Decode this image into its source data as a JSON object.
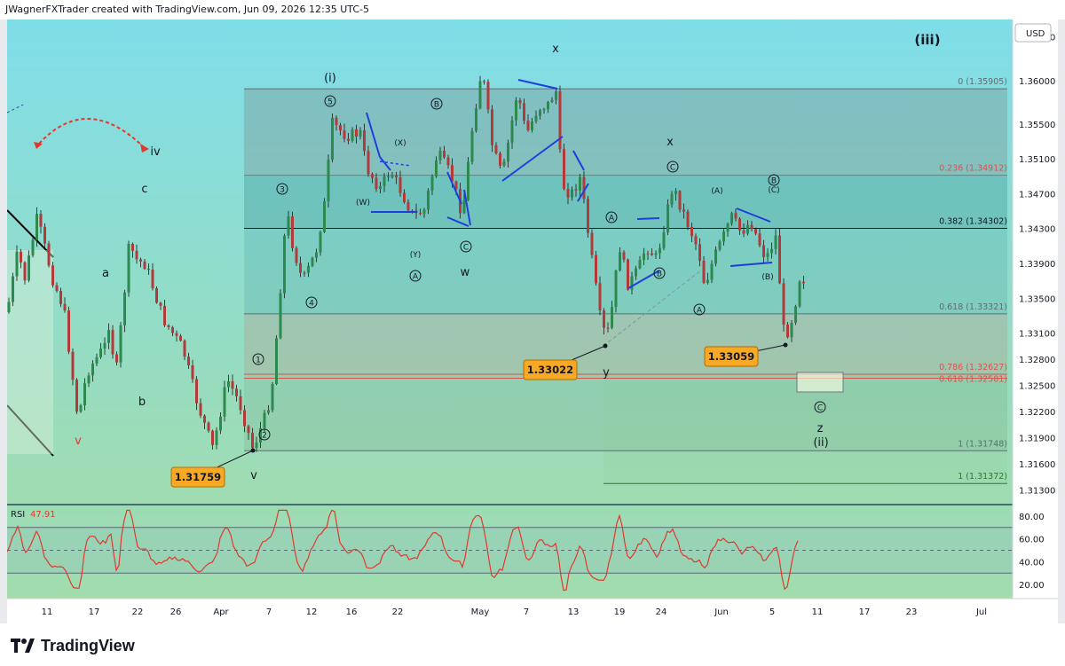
{
  "header": {
    "caption": "JWagnerFXTrader created with TradingView.com, Jun 09, 2026 12:35 UTC-5"
  },
  "currency_button": "USD",
  "footer": {
    "brand": "TradingView",
    "logo_icon": "tradingview-logo-icon"
  },
  "colors": {
    "bg_top": "#7fdde9",
    "bg_bottom": "#a8dca3",
    "candle_up": "#2d8a4e",
    "candle_down": "#b23a3a",
    "rsi": "#e0392e",
    "pattern_line": "#1f3fdc",
    "fib_red": "#d9534f",
    "label_bg": "#f7a824"
  },
  "chart_data": {
    "type": "candlestick",
    "symbol_currency": "USD",
    "y_axis": {
      "ticks": [
        "1.36500",
        "1.36000",
        "1.35500",
        "1.35100",
        "1.34700",
        "1.34300",
        "1.33900",
        "1.33500",
        "1.33100",
        "1.32800",
        "1.32500",
        "1.32200",
        "1.31900",
        "1.31600",
        "1.31300"
      ],
      "range": [
        1.3115,
        1.3665
      ]
    },
    "x_axis": {
      "ticks": [
        "11",
        "17",
        "22",
        "26",
        "Apr",
        "7",
        "12",
        "16",
        "22",
        "May",
        "7",
        "13",
        "19",
        "24",
        "Jun",
        "5",
        "11",
        "17",
        "23",
        "Jul"
      ]
    },
    "fib_levels": [
      {
        "label": "0 (1.35905)",
        "value": 1.35905,
        "color": "#5a6e74"
      },
      {
        "label": "0.236 (1.34912)",
        "value": 1.34912,
        "color": "#d9534f"
      },
      {
        "label": "0.382 (1.34302)",
        "value": 1.34302,
        "color": "#131722"
      },
      {
        "label": "0.618 (1.33321)",
        "value": 1.33321,
        "color": "#5a6e74"
      },
      {
        "label": "0.786 (1.32627)",
        "value": 1.32627,
        "color": "#d9534f"
      },
      {
        "label": "0.618 (1.32581)",
        "value": 1.32581,
        "color": "#d9534f"
      },
      {
        "label": "1 (1.31748)",
        "value": 1.31748,
        "color": "#5a6e74"
      },
      {
        "label": "1 (1.31372)",
        "value": 1.31372,
        "color": "#2a7a2a"
      }
    ],
    "price_labels": [
      "1.33022",
      "1.31759",
      "1.33059"
    ],
    "wave_labels": [
      "(iii)",
      "(i)",
      "x",
      "iv",
      "c",
      "a",
      "b",
      "v",
      "y",
      "w",
      "x",
      "z",
      "(ii)",
      "(W)",
      "(X)",
      "(Y)",
      "(A)",
      "(B)",
      "(C)",
      "(B)",
      "(A)",
      "(C)",
      "(B)"
    ],
    "circled_labels": [
      "1",
      "2",
      "3",
      "4",
      "5",
      "A",
      "B",
      "C",
      "A",
      "B",
      "C",
      "A",
      "B",
      "C",
      "C"
    ],
    "rsi": {
      "label": "RSI",
      "value": "47.91",
      "ticks": [
        "80.00",
        "60.00",
        "40.00",
        "20.00"
      ],
      "range": [
        10,
        90
      ],
      "bands": [
        70,
        50,
        30
      ]
    }
  }
}
